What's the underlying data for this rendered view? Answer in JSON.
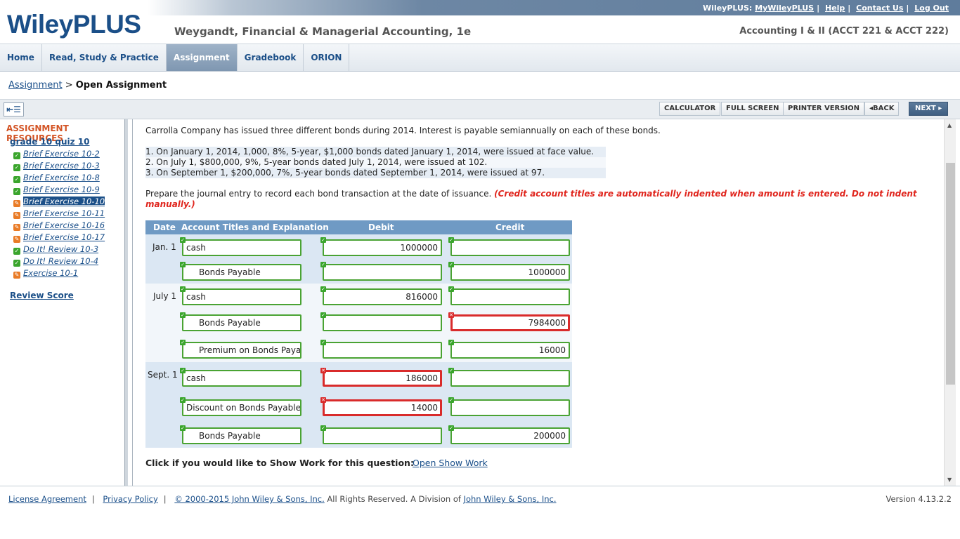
{
  "header": {
    "logo": "WileyPLUS",
    "book_title": "Weygandt, Financial & Managerial Accounting, 1e",
    "course_title": "Accounting I & II (ACCT 221 & ACCT 222)",
    "top_prefix": "WileyPLUS:",
    "top_links": [
      "MyWileyPLUS",
      "Help",
      "Contact Us",
      "Log Out"
    ]
  },
  "nav": {
    "tabs": [
      "Home",
      "Read, Study & Practice",
      "Assignment",
      "Gradebook",
      "ORION"
    ],
    "active": "Assignment"
  },
  "breadcrumb": {
    "link": "Assignment",
    "separator": ">",
    "current": "Open Assignment"
  },
  "toolbar": {
    "calculator": "CALCULATOR",
    "full_screen": "FULL SCREEN",
    "printer": "PRINTER VERSION",
    "back": "BACK",
    "next": "NEXT"
  },
  "sidebar": {
    "title": "ASSIGNMENT RESOURCES",
    "quiz": "grade 10 quiz 10",
    "items": [
      {
        "label": "Brief Exercise 10-2",
        "status": "complete"
      },
      {
        "label": "Brief Exercise 10-3",
        "status": "complete"
      },
      {
        "label": "Brief Exercise 10-8",
        "status": "complete"
      },
      {
        "label": "Brief Exercise 10-9",
        "status": "complete"
      },
      {
        "label": "Brief Exercise 10-10",
        "status": "partial"
      },
      {
        "label": "Brief Exercise 10-11",
        "status": "partial"
      },
      {
        "label": "Brief Exercise 10-16",
        "status": "partial"
      },
      {
        "label": "Brief Exercise 10-17",
        "status": "partial"
      },
      {
        "label": "Do It! Review 10-3",
        "status": "complete"
      },
      {
        "label": "Do It! Review 10-4",
        "status": "complete"
      },
      {
        "label": "Exercise 10-1",
        "status": "partial"
      }
    ],
    "selected_index": 4,
    "review_score": "Review Score"
  },
  "question": {
    "intro": "Carrolla Company has issued three different bonds during 2014. Interest is payable semiannually on each of these bonds.",
    "facts": [
      "1.  On January 1, 2014, 1,000, 8%, 5-year, $1,000 bonds dated January 1, 2014, were issued at face value.",
      "2.  On July 1, $800,000, 9%, 5-year bonds dated July 1, 2014, were issued at 102.",
      "3.  On September 1, $200,000, 7%, 5-year bonds dated September 1, 2014, were issued at 97."
    ],
    "prompt": "Prepare the journal entry to record each bond transaction at the date of issuance.",
    "prompt_note": "(Credit account titles are automatically indented when amount is entered. Do not indent manually.)"
  },
  "journal": {
    "headers": {
      "date": "Date",
      "account": "Account Titles and Explanation",
      "debit": "Debit",
      "credit": "Credit"
    },
    "entries": [
      {
        "date": "Jan. 1",
        "lines": [
          {
            "account": "cash",
            "debit": "1000000",
            "credit": "",
            "acc_ok": true,
            "deb_ok": true,
            "cre_ok": true
          },
          {
            "account": "Bonds Payable",
            "debit": "",
            "credit": "1000000",
            "acc_ok": true,
            "deb_ok": true,
            "cre_ok": true
          }
        ]
      },
      {
        "date": "July 1",
        "lines": [
          {
            "account": "cash",
            "debit": "816000",
            "credit": "",
            "acc_ok": true,
            "deb_ok": true,
            "cre_ok": true
          },
          {
            "account": "Bonds Payable",
            "debit": "",
            "credit": "7984000",
            "acc_ok": true,
            "deb_ok": true,
            "cre_ok": false
          },
          {
            "account": "Premium on Bonds Payable",
            "debit": "",
            "credit": "16000",
            "acc_ok": true,
            "deb_ok": true,
            "cre_ok": true
          }
        ]
      },
      {
        "date": "Sept. 1",
        "lines": [
          {
            "account": "cash",
            "debit": "186000",
            "credit": "",
            "acc_ok": true,
            "deb_ok": false,
            "cre_ok": true
          },
          {
            "account": "Discount on Bonds Payable",
            "debit": "14000",
            "credit": "",
            "acc_ok": true,
            "deb_ok": false,
            "cre_ok": true
          },
          {
            "account": "Bonds Payable",
            "debit": "",
            "credit": "200000",
            "acc_ok": true,
            "deb_ok": true,
            "cre_ok": true
          }
        ]
      }
    ]
  },
  "show_work": {
    "label": "Click if you would like to Show Work for this question:",
    "link": "Open Show Work"
  },
  "footer": {
    "license": "License Agreement",
    "privacy": "Privacy Policy",
    "copyright_link": "© 2000-2015 John Wiley & Sons, Inc.",
    "rights_text": "All Rights Reserved. A Division of",
    "division_link": "John Wiley & Sons, Inc.",
    "version": "Version 4.13.2.2"
  },
  "colors": {
    "brand": "#1b4f88",
    "correct": "#4aa333",
    "incorrect": "#d92b2b",
    "note_red": "#e0261e",
    "table_header": "#6f9ac4"
  }
}
